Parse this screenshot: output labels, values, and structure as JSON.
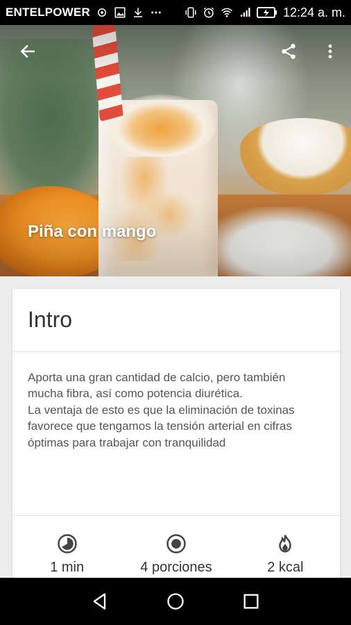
{
  "status_bar": {
    "carrier": "ENTELPOWER",
    "time": "12:24 a. m.",
    "icons": [
      "sync-icon",
      "image-icon",
      "download-icon",
      "more-notifications-icon",
      "vibrate-icon",
      "alarm-icon",
      "wifi-icon",
      "signal-icon",
      "battery-icon"
    ]
  },
  "header": {
    "title": "Piña con mango",
    "icons": [
      "back-arrow-icon",
      "share-icon",
      "more-vert-icon"
    ]
  },
  "card": {
    "title": "Intro",
    "body_line1": "Aporta una gran cantidad de calcio, pero también mucha fibra, así como potencia diurética.",
    "body_line2": "La ventaja de esto  es que la eliminación de toxinas favorece que tengamos la tensión arterial en cifras óptimas para trabajar con tranquilidad",
    "stats": [
      {
        "icon": "clock-icon",
        "label": "1 min"
      },
      {
        "icon": "servings-icon",
        "label": "4 porciones"
      },
      {
        "icon": "fire-icon",
        "label": "2 kcal"
      }
    ]
  },
  "nav": {
    "icons": [
      "back-triangle-icon",
      "home-circle-icon",
      "recents-square-icon"
    ]
  },
  "colors": {
    "status_bar": "#000000",
    "card_bg": "#ffffff",
    "page_bg": "#ededed",
    "text_dark": "#333333",
    "text_body": "#555555"
  }
}
